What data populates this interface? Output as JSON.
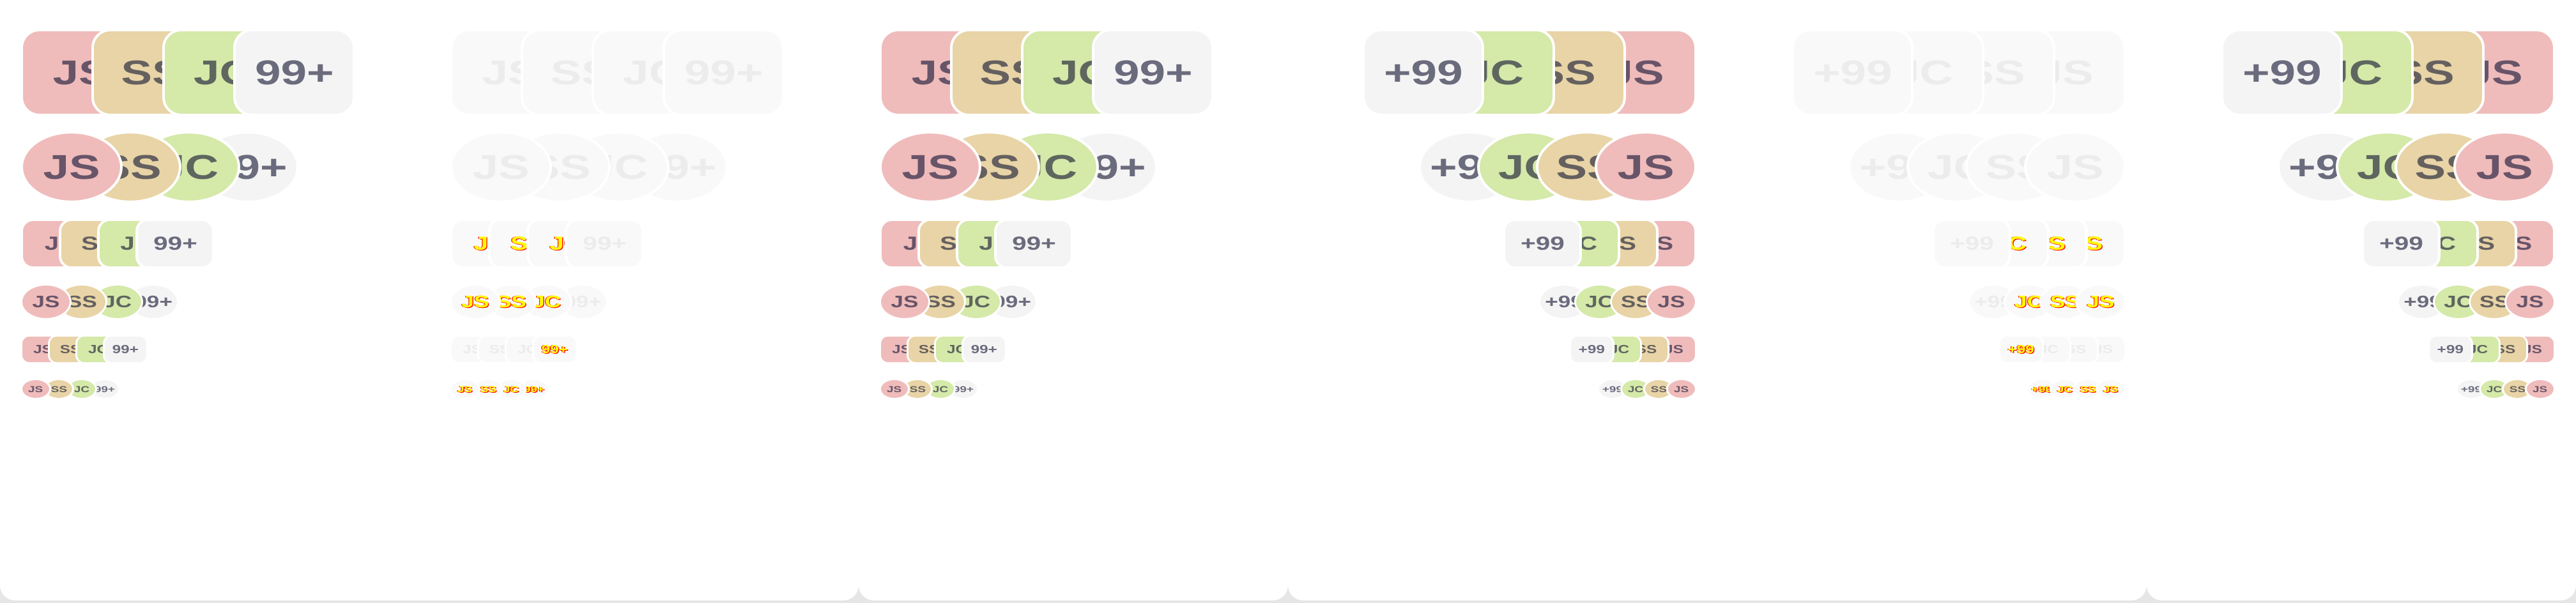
{
  "colors": {
    "pink": "#efbcbb",
    "pink_text": "#685468",
    "tan": "#e8d4a6",
    "tan_text": "#65605f",
    "green": "#d5e9a9",
    "green_text": "#5e665f",
    "grey": "#f4f4f4",
    "grey_text": "#6b6b7e"
  },
  "avatars": [
    {
      "initials": "JS",
      "color": "pink"
    },
    {
      "initials": "SS",
      "color": "tan"
    },
    {
      "initials": "JC",
      "color": "green"
    }
  ],
  "overflow_label": "99+",
  "overflow_label_reversed": "+99",
  "rows": [
    {
      "size": "xl",
      "shape": "rounded"
    },
    {
      "size": "xl",
      "shape": "circle"
    },
    {
      "size": "lg",
      "shape": "rounded"
    },
    {
      "size": "md",
      "shape": "circle"
    },
    {
      "size": "sm",
      "shape": "rounded"
    },
    {
      "size": "xs",
      "shape": "circle"
    }
  ],
  "panels": [
    {
      "direction": "ltr",
      "state": "default"
    },
    {
      "direction": "ltr",
      "state": "disabled"
    },
    {
      "direction": "ltr",
      "state": "default"
    },
    {
      "direction": "rtl",
      "state": "default"
    },
    {
      "direction": "rtl",
      "state": "disabled"
    },
    {
      "direction": "rtl",
      "state": "default"
    }
  ]
}
